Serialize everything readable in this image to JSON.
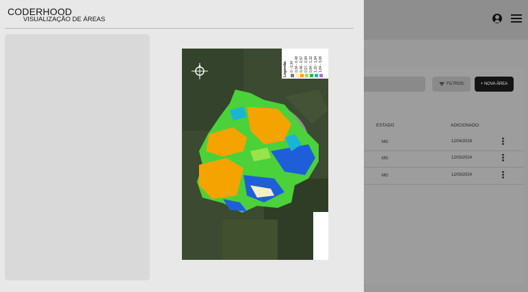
{
  "background_app": {
    "filter_button_label": "FILTROS",
    "new_area_button_label": "+ NOVA ÁREA",
    "table": {
      "headers": {
        "state": "ESTADO",
        "added": "ADICIONADO"
      },
      "rows": [
        {
          "state": "MG",
          "date": "12/04/2026"
        },
        {
          "state": "MG",
          "date": "12/03/2024"
        },
        {
          "state": "MG",
          "date": "12/03/2024"
        }
      ]
    }
  },
  "drawer": {
    "title": "CODERHOOD",
    "subtitle": "VISUALIZAÇÃO DE ÁREAS"
  },
  "map": {
    "legend": {
      "title": "Legenda:",
      "items": [
        {
          "label": "0 - 0,34",
          "color": "#7a7a7a"
        },
        {
          "label": "0,34 - 0,48",
          "color": "#f2efc2"
        },
        {
          "label": "0,48 - 0,57",
          "color": "#f5a300"
        },
        {
          "label": "0,57 - 0,94",
          "color": "#9be34a"
        },
        {
          "label": "0,94 - 1,32",
          "color": "#2bb845"
        },
        {
          "label": "1,32 - 1,84",
          "color": "#18b5d6"
        },
        {
          "label": "1,84 - 3,06",
          "color": "#b36fd6"
        }
      ]
    }
  },
  "colors": {
    "drawer_bg": "#e8e8e8",
    "card_bg": "#d9d9d9",
    "overlay_bg": "#9a9a9a",
    "primary_button": "#141414"
  }
}
